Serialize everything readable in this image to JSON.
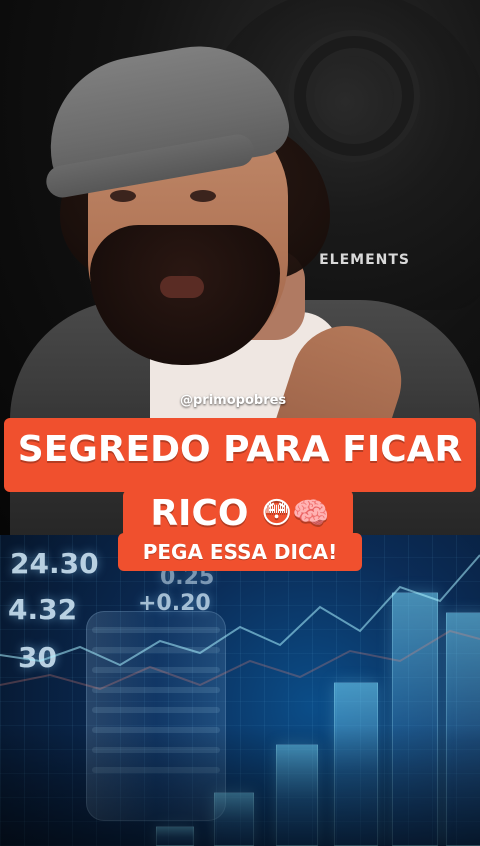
{
  "overlay": {
    "handle": "@primopobres",
    "title_line1": "SEGREDO PARA FICAR",
    "title_line2_text": "RICO",
    "title_line2_emojis": "😳🧠",
    "badge": "PEGA ESSA DICA!"
  },
  "background": {
    "chair_brand": "ELEMENTS"
  },
  "finance_image": {
    "numbers": [
      "24.30",
      "4.32",
      "+0.20",
      "30",
      "0.25"
    ]
  },
  "colors": {
    "accent_orange": "#f0502e",
    "finance_blue": "#0b4d88"
  }
}
